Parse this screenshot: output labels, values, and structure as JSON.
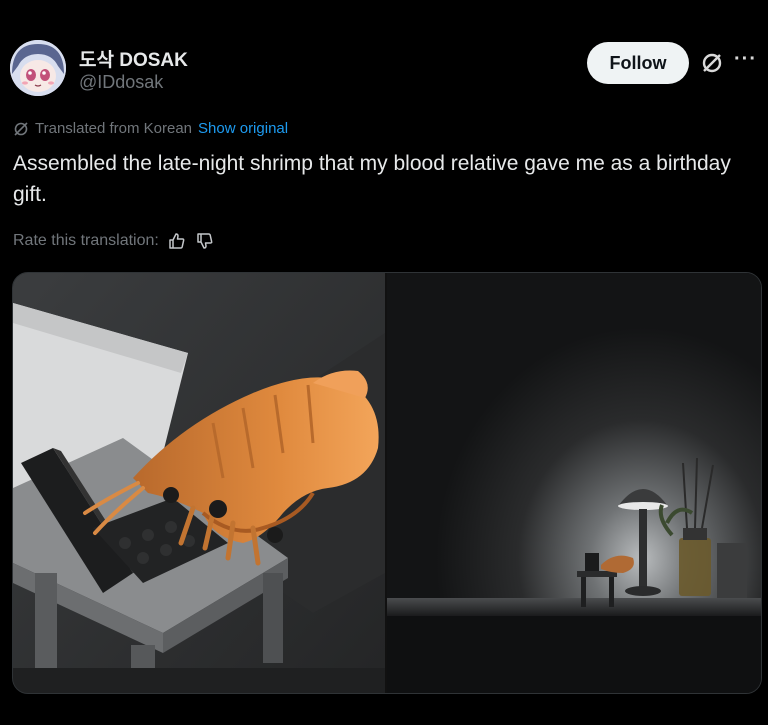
{
  "author": {
    "display_name": "도삭 DOSAK",
    "handle": "@IDdosak"
  },
  "actions": {
    "follow_label": "Follow",
    "grok_icon": "grok-icon",
    "more_icon": "more-dots-icon"
  },
  "translation": {
    "label": "Translated from Korean",
    "show_original": "Show original",
    "rate_label": "Rate this translation:"
  },
  "tweet": {
    "text": "Assembled the late-night shrimp that my blood relative gave me as a birthday gift."
  },
  "media": {
    "count": 2,
    "items": [
      "lego-shrimp-closeup-photo",
      "lego-shrimp-desk-lamp-photo"
    ]
  },
  "colors": {
    "background": "#000000",
    "text": "#e7e9ea",
    "muted": "#71767b",
    "link": "#1d9bf0",
    "follow_bg": "#eff3f4"
  }
}
